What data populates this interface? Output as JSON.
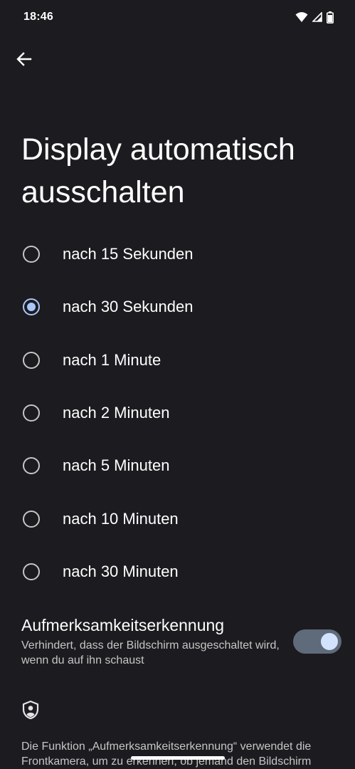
{
  "status_bar": {
    "time": "18:46",
    "icons": [
      "wifi-icon",
      "cell-signal-icon",
      "battery-icon"
    ]
  },
  "nav": {
    "back_icon": "arrow-left-icon"
  },
  "title": "Display automatisch ausschalten",
  "timeout_options": [
    {
      "label": "nach 15 Sekunden",
      "checked": false
    },
    {
      "label": "nach 30 Sekunden",
      "checked": true
    },
    {
      "label": "nach 1 Minute",
      "checked": false
    },
    {
      "label": "nach 2 Minuten",
      "checked": false
    },
    {
      "label": "nach 5 Minuten",
      "checked": false
    },
    {
      "label": "nach 10 Minuten",
      "checked": false
    },
    {
      "label": "nach 30 Minuten",
      "checked": false
    }
  ],
  "attention": {
    "title": "Aufmerksamkeitserkennung",
    "subtitle": "Verhindert, dass der Bildschirm ausgeschaltet wird, wenn du auf ihn schaust",
    "enabled": true
  },
  "privacy_icon": "shield-person-icon",
  "footer": "Die Funktion „Aufmerksamkeitserkennung“ verwendet die Frontkamera, um zu erkennen, ob jemand den Bildschirm",
  "colors": {
    "background": "#1c1b1f",
    "accent": "#a8c7fa",
    "toggle_track": "#5f6b7a"
  }
}
